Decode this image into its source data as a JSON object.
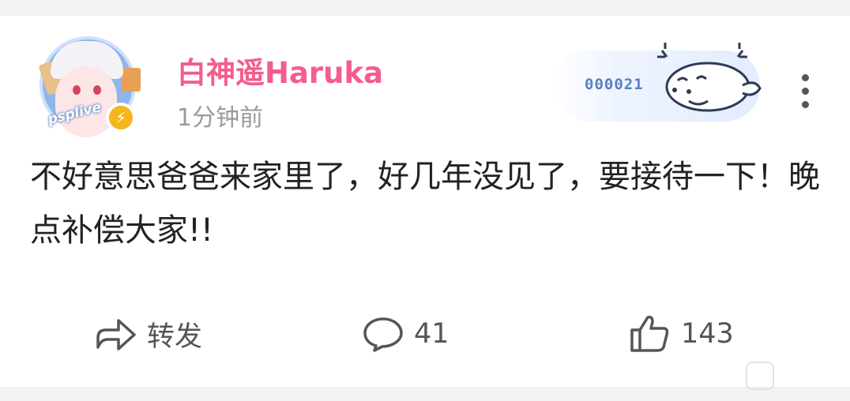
{
  "post": {
    "username": "白神遥Haruka",
    "time": "1分钟前",
    "avatar_label": "psplive",
    "verified_badge_icon": "lightning-icon",
    "fan_card_number": "000021",
    "text": "不好意思爸爸来家里了，好几年没见了，要接待一下！晚点补偿大家!!"
  },
  "actions": {
    "share_label": "转发",
    "comment_count": "41",
    "like_count": "143"
  },
  "colors": {
    "username": "#f45d8c",
    "background": "#f2f2f4",
    "fan_card": "#e3edff",
    "badge": "#f5b51b"
  }
}
